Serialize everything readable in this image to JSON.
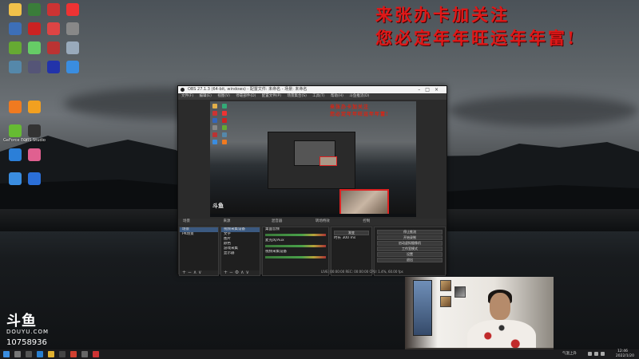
{
  "overlay": {
    "line1": "来张办卡加关注",
    "line2": "您必定年年旺运年年富!"
  },
  "desktop_icons": [
    {
      "label": "",
      "color": "#f1c14a"
    },
    {
      "label": "",
      "color": "#3a7d3a"
    },
    {
      "label": "",
      "color": "#c33"
    },
    {
      "label": "",
      "color": "#e33"
    },
    {
      "label": "",
      "color": "#3d6fb8"
    },
    {
      "label": "",
      "color": "#c22"
    },
    {
      "label": "",
      "color": "#d44"
    },
    {
      "label": "",
      "color": "#888"
    },
    {
      "label": "",
      "color": "#6a3"
    },
    {
      "label": "",
      "color": "#6c6"
    },
    {
      "label": "",
      "color": "#b33"
    },
    {
      "label": "",
      "color": "#9ab"
    },
    {
      "label": "",
      "color": "#58a"
    },
    {
      "label": "",
      "color": "#557"
    },
    {
      "label": "",
      "color": "#23a"
    },
    {
      "label": "",
      "color": "#3a8de0"
    },
    {
      "label": "",
      "color": "#f07a20"
    },
    {
      "label": "",
      "color": "#f2a020"
    },
    {
      "label": "GeForce Experience",
      "color": "#6b3"
    },
    {
      "label": "OBS Studio",
      "color": "#333"
    },
    {
      "label": "",
      "color": "#2b7fd8"
    },
    {
      "label": "",
      "color": "#e06090"
    },
    {
      "label": "",
      "color": "#3a8de0"
    },
    {
      "label": "",
      "color": "#2b6fd8"
    }
  ],
  "obs": {
    "title": "OBS 27.1.3 (64-bit, windows) - 配置文件: 未命名 - 场景: 未命名",
    "menu": [
      "文件(F)",
      "编辑(E)",
      "视图(V)",
      "停靠部件(D)",
      "配置文件(P)",
      "场景集合(S)",
      "工具(T)",
      "帮助(H)",
      "斗鱼推流(D)"
    ],
    "scene_bar": [
      "场景",
      "来源",
      "混音器",
      "转场特效",
      "控制"
    ],
    "scene_list": [
      "场景",
      "PK场景"
    ],
    "sources": [
      "视频采集设备",
      "文字",
      "图片",
      "颜色",
      "游戏采集",
      "显示器"
    ],
    "mixer": [
      "桌面音频",
      "麦克风/Aux",
      "视频采集设备"
    ],
    "transition_labels": [
      "渐变",
      "时长"
    ],
    "transition_duration": "300 ms",
    "controls": [
      "停止推流",
      "开始录制",
      "启动虚拟摄像机",
      "工作室模式",
      "设置",
      "退出"
    ],
    "status": "LIVE: 00:00:00   REC: 00:00:00   CPU: 1.4%, 60.00 fps"
  },
  "douyu": {
    "logo": "斗鱼",
    "domain": "DOUYU.COM",
    "room_id": "10758936"
  },
  "taskbar": {
    "weather": "气温上升",
    "time": "12:46",
    "date": "2022/1/20"
  }
}
